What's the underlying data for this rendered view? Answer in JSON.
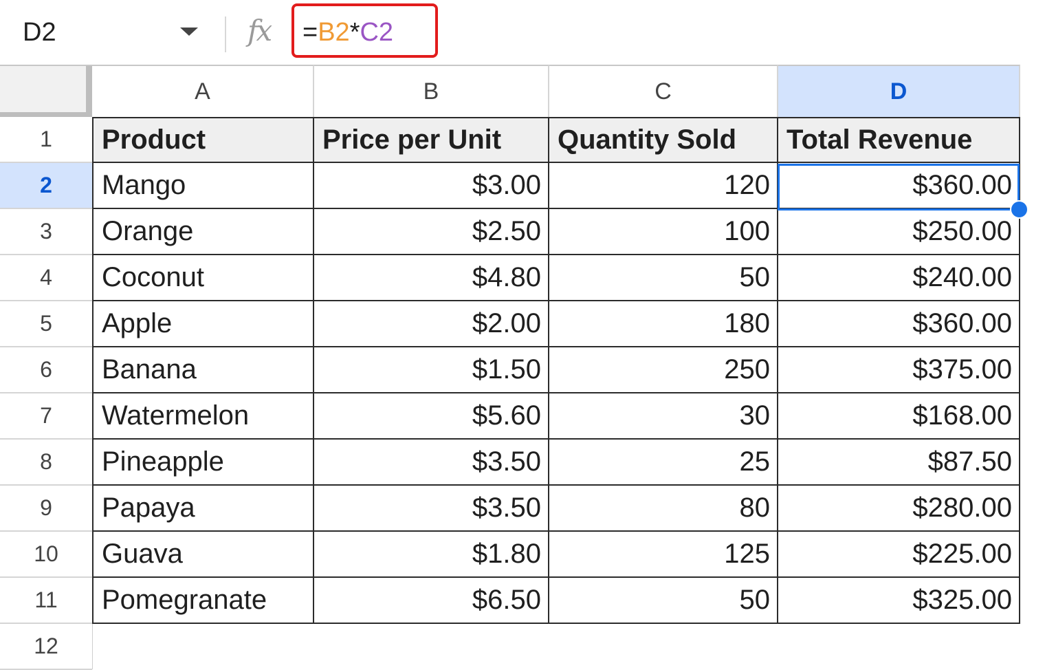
{
  "name_box": {
    "ref": "D2"
  },
  "formula_bar": {
    "fx_label": "fx",
    "formula": {
      "eq": "=",
      "ref1": "B2",
      "op": "*",
      "ref2": "C2"
    }
  },
  "colors": {
    "selection": "#1a73e8",
    "header_selected_bg": "#d3e3fd",
    "formula_highlight": "#e21c1c",
    "ref1": "#f09a34",
    "ref2": "#9a55c4"
  },
  "columns": [
    "A",
    "B",
    "C",
    "D"
  ],
  "selected_column": "D",
  "selected_row": 2,
  "row_numbers": [
    "1",
    "2",
    "3",
    "4",
    "5",
    "6",
    "7",
    "8",
    "9",
    "10",
    "11",
    "12"
  ],
  "table": {
    "headers": [
      "Product",
      "Price per Unit",
      "Quantity Sold",
      "Total Revenue"
    ],
    "rows": [
      [
        "Mango",
        "$3.00",
        "120",
        "$360.00"
      ],
      [
        "Orange",
        "$2.50",
        "100",
        "$250.00"
      ],
      [
        "Coconut",
        "$4.80",
        "50",
        "$240.00"
      ],
      [
        "Apple",
        "$2.00",
        "180",
        "$360.00"
      ],
      [
        "Banana",
        "$1.50",
        "250",
        "$375.00"
      ],
      [
        "Watermelon",
        "$5.60",
        "30",
        "$168.00"
      ],
      [
        "Pineapple",
        "$3.50",
        "25",
        "$87.50"
      ],
      [
        "Papaya",
        "$3.50",
        "80",
        "$280.00"
      ],
      [
        "Guava",
        "$1.80",
        "125",
        "$225.00"
      ],
      [
        "Pomegranate",
        "$6.50",
        "50",
        "$325.00"
      ]
    ]
  }
}
